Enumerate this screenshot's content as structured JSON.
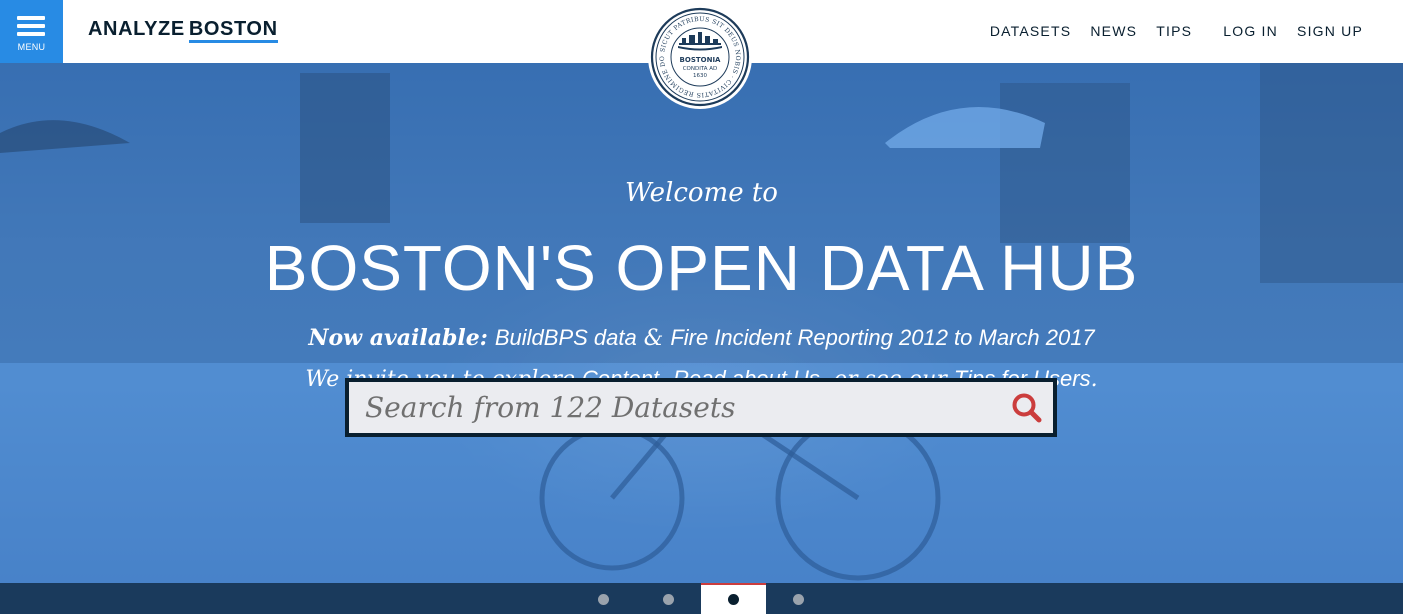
{
  "header": {
    "menu_label": "MENU",
    "brand_part1": "ANALYZE",
    "brand_part2": "BOSTON",
    "nav": [
      {
        "label": "DATASETS"
      },
      {
        "label": "NEWS"
      },
      {
        "label": "TIPS"
      },
      {
        "label": "LOG IN"
      },
      {
        "label": "SIGN UP"
      }
    ],
    "seal": {
      "ring_text": "SICUT PATRIBUS SIT DEUS NOBIS · CIVITATIS REGIMINE DONATA A.D. 1822",
      "center_name": "BOSTONIA",
      "center_line2": "CONDITA AD",
      "center_year": "1630"
    }
  },
  "hero": {
    "welcome": "Welcome to",
    "headline": "BOSTON'S OPEN DATA HUB",
    "announce_lead": "Now available:",
    "announce_item1": "BuildBPS data",
    "announce_amp": "&",
    "announce_item2": "Fire Incident Reporting 2012 to March 2017",
    "invite_lead": "We invite you to explore",
    "invite_link1": "Content",
    "invite_comma": ",",
    "invite_link2": "Read about Us",
    "invite_mid": ", or see our",
    "invite_link3": "Tips for Users",
    "invite_end": "."
  },
  "search": {
    "placeholder": "Search from 122 Datasets",
    "value": ""
  },
  "carousel": {
    "slide_count": 4,
    "active_index": 2
  },
  "colors": {
    "brand_navy": "#091f2f",
    "optimistic_blue": "#288be4",
    "freedom_red": "#cb3d3d",
    "hero_overlay": "#3f7ac3"
  }
}
